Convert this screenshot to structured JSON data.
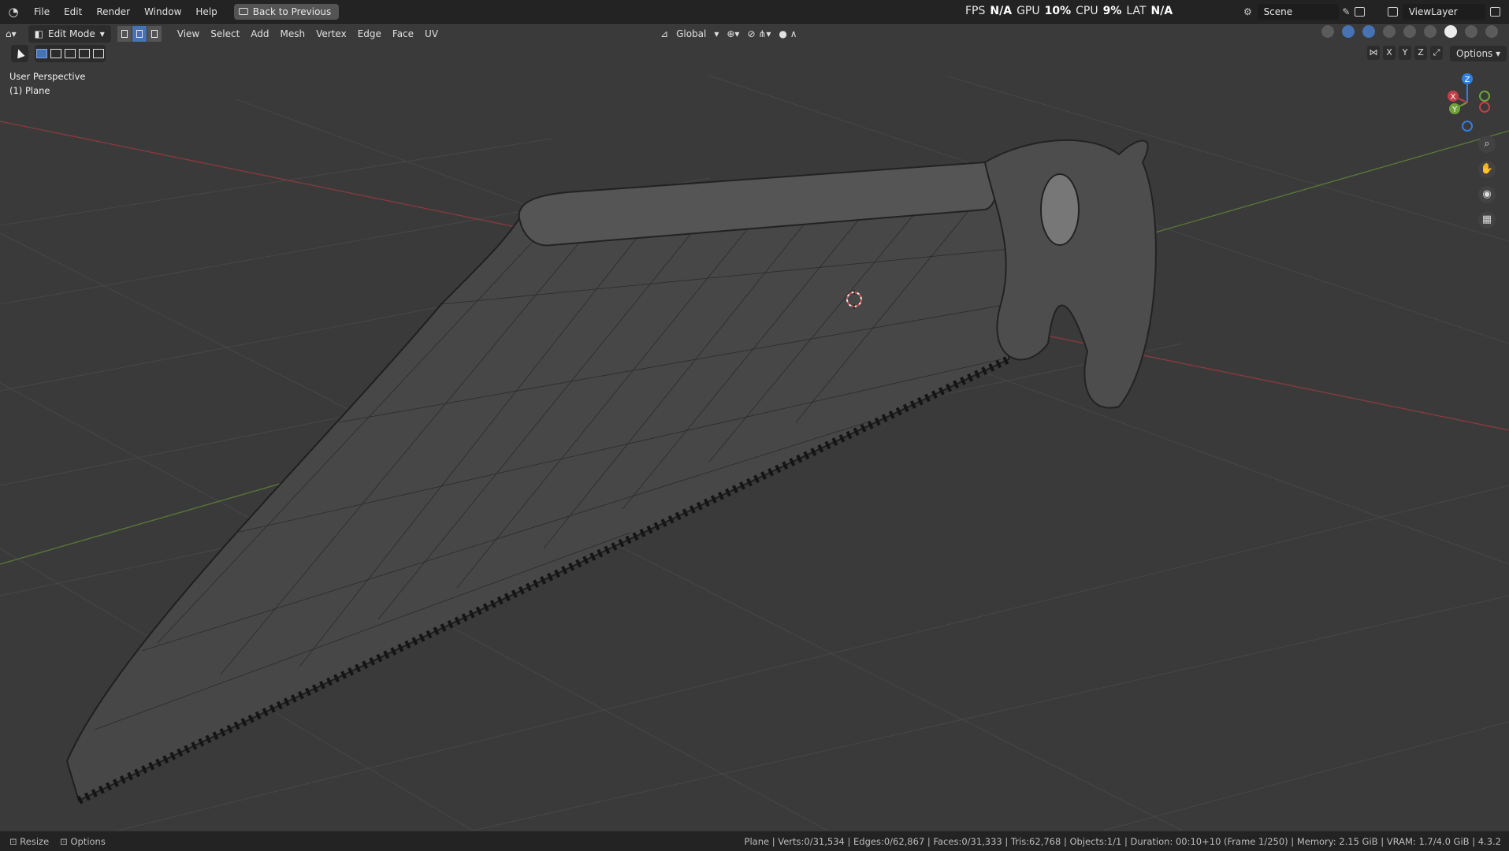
{
  "menubar": {
    "items": [
      "File",
      "Edit",
      "Render",
      "Window",
      "Help"
    ],
    "back_button": "Back to Previous"
  },
  "perf": {
    "fps_label": "FPS",
    "fps": "N/A",
    "gpu_label": "GPU",
    "gpu": "10%",
    "cpu_label": "CPU",
    "cpu": "9%",
    "lat_label": "LAT",
    "lat": "N/A"
  },
  "scene": {
    "value": "Scene"
  },
  "viewlayer": {
    "value": "ViewLayer"
  },
  "header": {
    "mode": "Edit Mode",
    "menus": [
      "View",
      "Select",
      "Add",
      "Mesh",
      "Vertex",
      "Edge",
      "Face",
      "UV"
    ],
    "orientation": "Global",
    "options": "Options"
  },
  "axes_buttons": [
    "X",
    "Y",
    "Z"
  ],
  "viewport": {
    "perspective": "User Perspective",
    "object": "(1) Plane"
  },
  "gizmo": {
    "x": "X",
    "y": "Y",
    "z": "Z"
  },
  "statusbar": {
    "resize": "Resize",
    "options": "Options",
    "info": "Plane | Verts:0/31,534 | Edges:0/62,867 | Faces:0/31,333 | Tris:62,768 | Objects:1/1 | Duration: 00:10+10 (Frame 1/250) | Memory: 2.15 GiB | VRAM: 1.7/4.0 GiB | 4.3.2"
  },
  "colors": {
    "accent": "#4772b3",
    "x_axis": "#c0404a",
    "y_axis": "#6fa23b",
    "z_axis": "#2f7fe0",
    "viewport_bg": "#3a3a3a"
  }
}
